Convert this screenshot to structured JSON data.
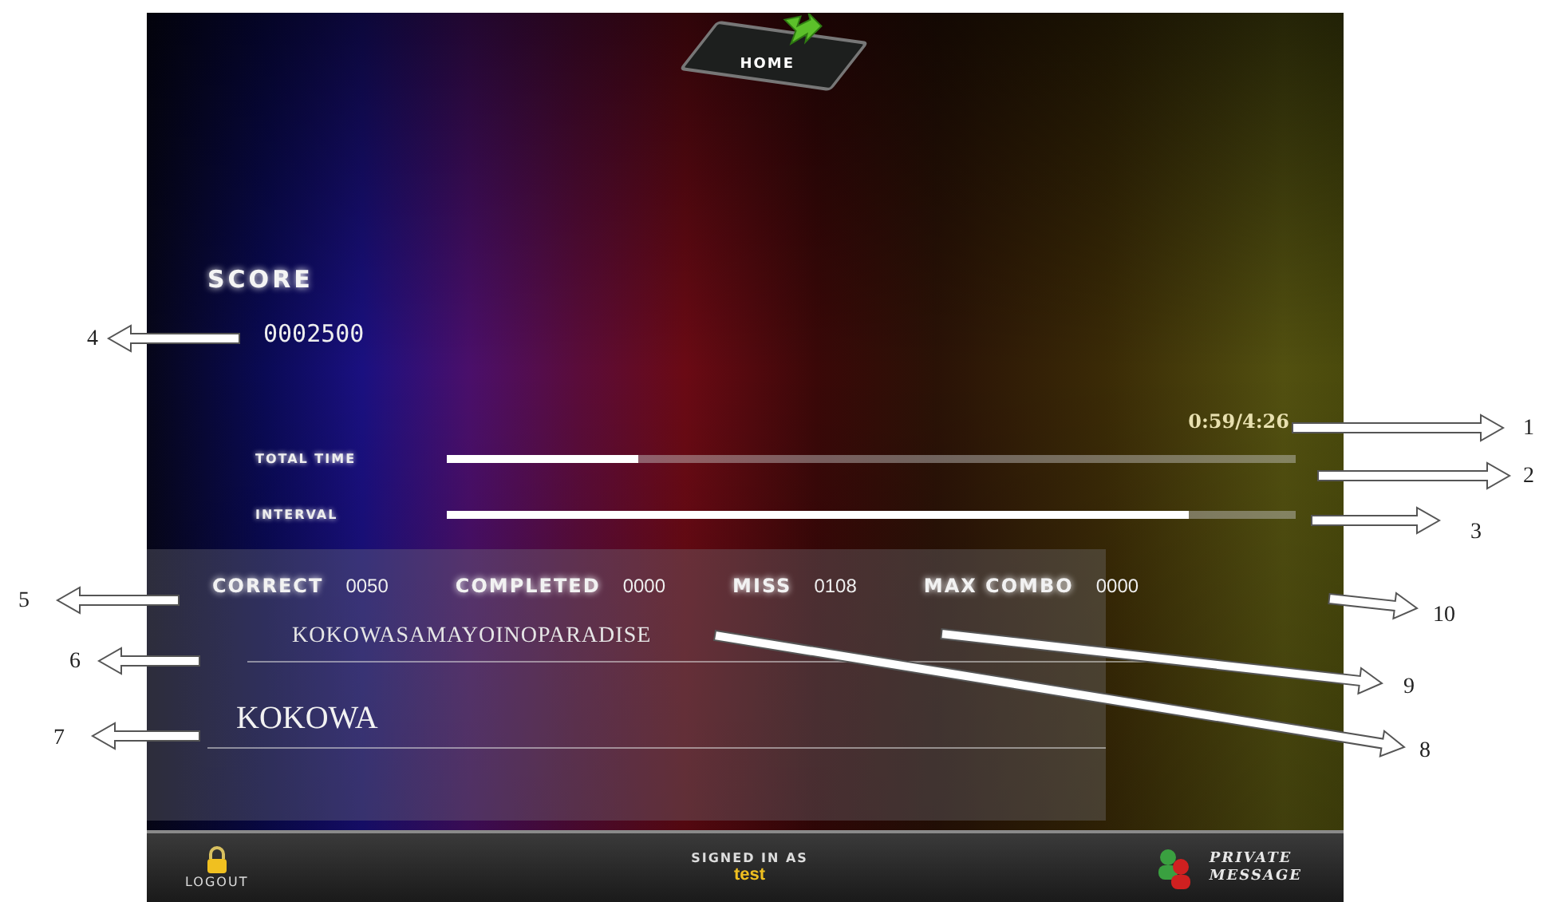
{
  "home_button": {
    "label": "HOME"
  },
  "score": {
    "label": "SCORE",
    "value": "0002500"
  },
  "time_reading": "0:59/4:26",
  "progress_bars": [
    {
      "label": "TOTAL TIME",
      "level": 0.226
    },
    {
      "label": "INTERVAL",
      "level": 0.874
    }
  ],
  "stats": [
    {
      "label": "CORRECT",
      "value": "0050"
    },
    {
      "label": "COMPLETED",
      "value": "0000"
    },
    {
      "label": "MISS",
      "value": "0108"
    },
    {
      "label": "MAX COMBO",
      "value": "0000"
    }
  ],
  "song_title": "KOKOWASAMAYOINOPARADISE",
  "typed_text": "KOKOWA",
  "bottom_bar": {
    "logout": "LOGOUT",
    "signed_in_label": "SIGNED IN AS",
    "username": "test",
    "private_message": [
      "PRIVATE",
      "MESSAGE"
    ]
  },
  "annotations": [
    {
      "label": "1"
    },
    {
      "label": "2"
    },
    {
      "label": "3"
    },
    {
      "label": "4"
    },
    {
      "label": "5"
    },
    {
      "label": "6"
    },
    {
      "label": "7"
    },
    {
      "label": "8"
    },
    {
      "label": "9"
    },
    {
      "label": "10"
    }
  ]
}
